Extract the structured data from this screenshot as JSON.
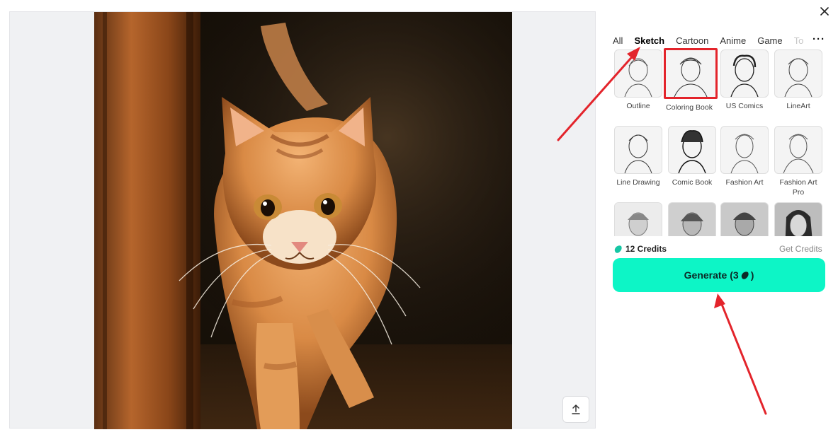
{
  "canvas": {
    "image_alt": "orange tabby cat walking",
    "upload_icon": "upload-arrow-icon"
  },
  "close_icon": "close-icon",
  "tabs": [
    "All",
    "Sketch",
    "Cartoon",
    "Anime",
    "Game",
    "To"
  ],
  "active_tab": "Sketch",
  "more_icon": "more-dots-icon",
  "more_label": "···",
  "styles": [
    {
      "label": "Outline",
      "selected": false
    },
    {
      "label": "Coloring Book",
      "selected": true
    },
    {
      "label": "US Comics",
      "selected": false
    },
    {
      "label": "LineArt",
      "selected": false
    },
    {
      "label": "Line Drawing",
      "selected": false
    },
    {
      "label": "Comic Book",
      "selected": false
    },
    {
      "label": "Fashion Art",
      "selected": false
    },
    {
      "label": "Fashion Art Pro",
      "selected": false
    },
    {
      "label": "",
      "selected": false
    },
    {
      "label": "",
      "selected": false
    },
    {
      "label": "",
      "selected": false
    },
    {
      "label": "",
      "selected": false
    }
  ],
  "credits": {
    "label": "12 Credits",
    "icon": "credit-coin-icon",
    "get_label": "Get Credits"
  },
  "generate": {
    "label": "Generate (3",
    "suffix": ")",
    "icon": "credit-coin-icon"
  },
  "colors": {
    "accent": "#0df5c6",
    "annotation": "#e3242b"
  }
}
